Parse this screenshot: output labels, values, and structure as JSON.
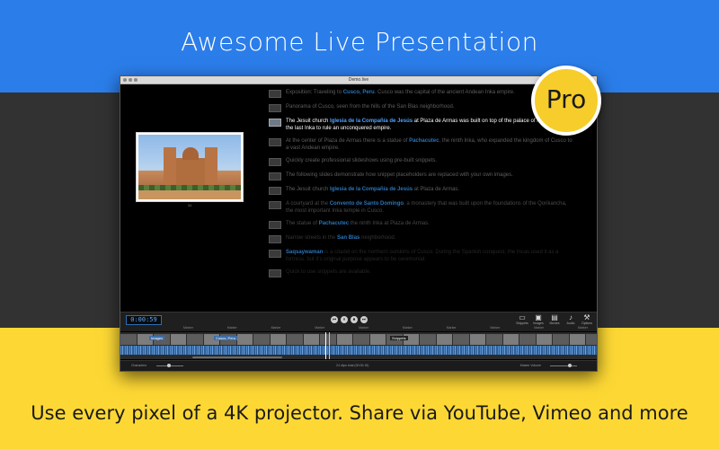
{
  "headline": "Awesome Live Presentation",
  "tagline": "Use every pixel of a 4K projector. Share via YouTube, Vimeo and more",
  "badge": "Pro",
  "window": {
    "title": "Demo.live"
  },
  "preview": {
    "slide_number": "34"
  },
  "script_rows": [
    {
      "state": "past",
      "pre": "Exposition: Traveling to ",
      "link": "Cusco, Peru",
      "post": ". Cusco was the capital of the ancient Andean Inka empire."
    },
    {
      "state": "past",
      "pre": "Panorama of Cusco, seen from the hills of the San Blas neighborhood.",
      "link": "",
      "post": ""
    },
    {
      "state": "current",
      "pre": "The Jesuit church ",
      "link": "Iglesia de la Compañía de Jesús",
      "post": " at Plaza de Armas was built on top of the palace of Huayna Cápac, the last Inka to rule an unconquered empire."
    },
    {
      "state": "next",
      "pre": "At the center of Plaza de Armas there is a statue of ",
      "link": "Pachacutec",
      "post": ", the ninth Inka, who expanded the kingdom of Cusco to a vast Andean empire."
    },
    {
      "state": "next",
      "pre": "Quickly create professional slideshows using pre-built snippets.",
      "link": "",
      "post": ""
    },
    {
      "state": "next",
      "pre": "The following slides demonstrate how snippet placeholders are replaced with your own images.",
      "link": "",
      "post": ""
    },
    {
      "state": "next",
      "pre": "The Jesuit church ",
      "link": "Iglesia de la Compañía de Jesús",
      "post": " at Plaza de Armas."
    },
    {
      "state": "fade1",
      "pre": "A courtyard at the ",
      "link": "Convento de Santo Domingo",
      "post": ", a monastery that was built upon the foundations of the Qorikancha, the most important Inka temple in Cusco."
    },
    {
      "state": "fade1",
      "pre": "The statue of ",
      "link": "Pachacutec",
      "post": " the ninth Inka at Plaza de Armas."
    },
    {
      "state": "fade2",
      "pre": "Narrow streets in the ",
      "link": "San Blas",
      "post": " neighborhood."
    },
    {
      "state": "fade3",
      "pre": "",
      "link": "Saqsaywaman",
      "post": " is a citadel on the northern outskirts of Cusco. During the Spanish conquest, the Incas used it as a fortress, but it's original purpose appears to be ceremonial."
    },
    {
      "state": "fade3",
      "pre": "Quick to use snippets are available.",
      "link": "",
      "post": ""
    }
  ],
  "controls": {
    "timer": "0:00:59",
    "transport": [
      "⏮",
      "⏸",
      "⏹",
      "⏭"
    ],
    "tools": [
      {
        "icon": "▭",
        "label": "Snippets",
        "name": "snippets"
      },
      {
        "icon": "▣",
        "label": "Images",
        "name": "images"
      },
      {
        "icon": "▤",
        "label": "Movies",
        "name": "movies"
      },
      {
        "icon": "♪",
        "label": "Audio",
        "name": "audio"
      },
      {
        "icon": "⚒",
        "label": "Options",
        "name": "options"
      }
    ],
    "markers": [
      "Marker",
      "Marker",
      "Marker",
      "Marker",
      "Marker",
      "Marker",
      "Marker",
      "Marker",
      "Marker",
      "Marker"
    ]
  },
  "timeline": {
    "clips": [
      "Images",
      "Cusco, Peru",
      "Snippets"
    ]
  },
  "statusbar": {
    "left": "Characters",
    "mid": "24 clips total (00:00:15)",
    "right": "Master Volume"
  },
  "colors": {
    "top_band": "#2b7de9",
    "middle_band": "#323232",
    "bottom_band": "#fdd834",
    "link": "#2a74b8",
    "badge": "#f6cd2a"
  }
}
